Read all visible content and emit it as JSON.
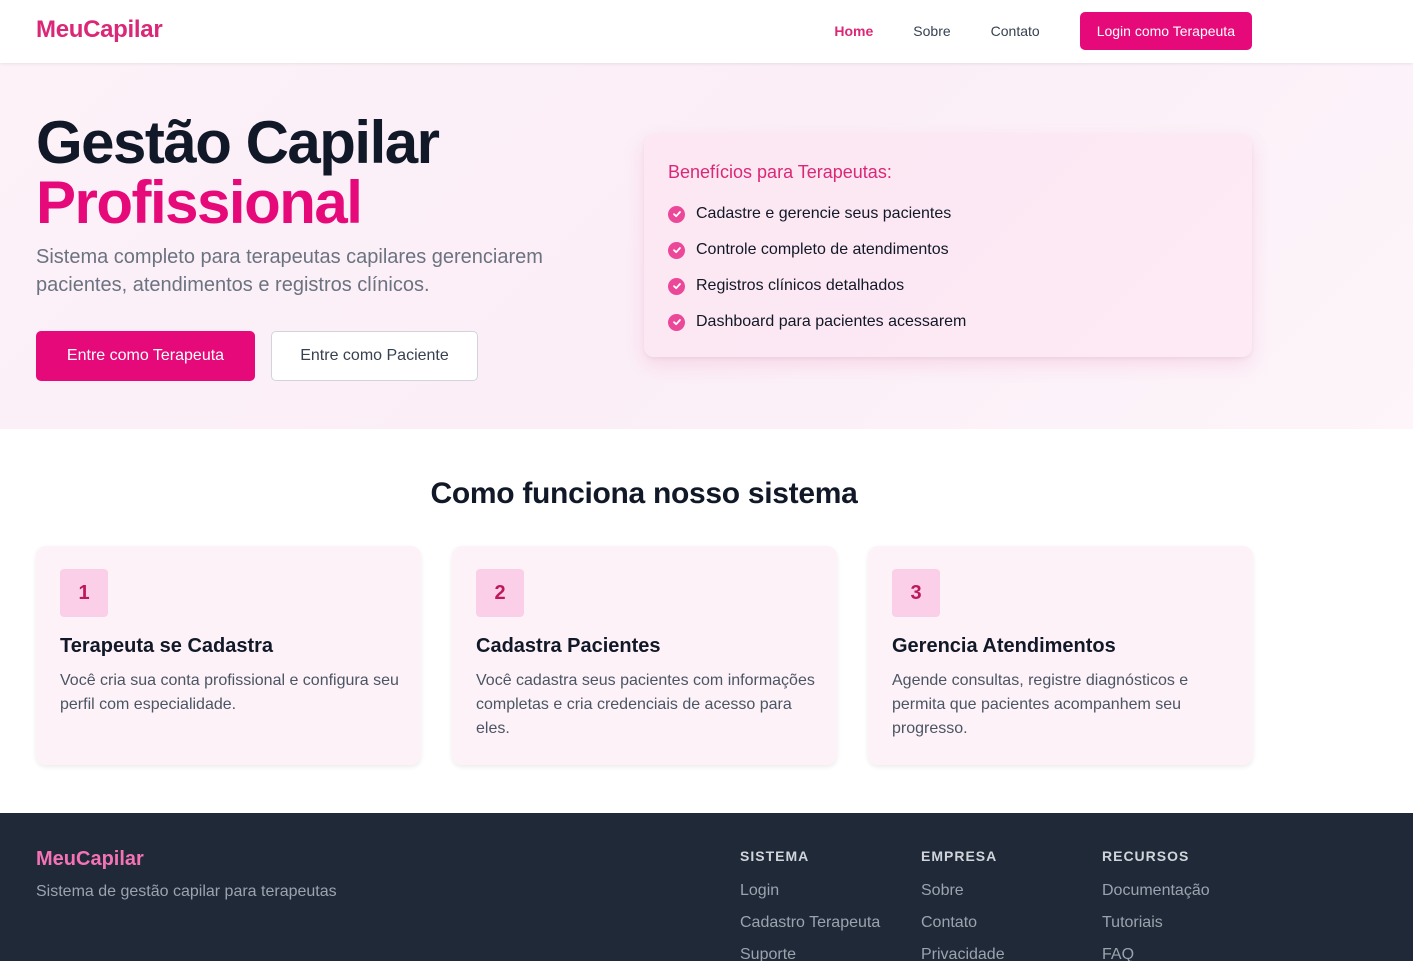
{
  "nav": {
    "brand": "MeuCapilar",
    "links": [
      "Home",
      "Sobre",
      "Contato"
    ],
    "login_button": "Login como Terapeuta"
  },
  "hero": {
    "title_line1": "Gestão Capilar",
    "title_line2": "Profissional",
    "subtitle": "Sistema completo para terapeutas capilares gerenciarem pacientes, atendimentos e registros clínicos.",
    "primary_button": "Entre como Terapeuta",
    "secondary_button": "Entre como Paciente"
  },
  "benefits": {
    "title": "Benefícios para Terapeutas:",
    "items": [
      "Cadastre e gerencie seus pacientes",
      "Controle completo de atendimentos",
      "Registros clínicos detalhados",
      "Dashboard para pacientes acessarem"
    ]
  },
  "how": {
    "title": "Como funciona nosso sistema",
    "steps": [
      {
        "num": "1",
        "title": "Terapeuta se Cadastra",
        "desc": "Você cria sua conta profissional e configura seu perfil com especialidade."
      },
      {
        "num": "2",
        "title": "Cadastra Pacientes",
        "desc": "Você cadastra seus pacientes com informações completas e cria credenciais de acesso para eles."
      },
      {
        "num": "3",
        "title": "Gerencia Atendimentos",
        "desc": "Agende consultas, registre diagnósticos e permita que pacientes acompanhem seu progresso."
      }
    ]
  },
  "footer": {
    "brand": "MeuCapilar",
    "tagline": "Sistema de gestão capilar para terapeutas",
    "columns": [
      {
        "heading": "SISTEMA",
        "links": [
          "Login",
          "Cadastro Terapeuta",
          "Suporte"
        ]
      },
      {
        "heading": "EMPRESA",
        "links": [
          "Sobre",
          "Contato",
          "Privacidade"
        ]
      },
      {
        "heading": "RECURSOS",
        "links": [
          "Documentação",
          "Tutoriais",
          "FAQ"
        ]
      }
    ]
  },
  "colors": {
    "brand_pink": "#e5097a",
    "hero_bg": "#fdf2f8",
    "footer_bg": "#1f2937"
  }
}
